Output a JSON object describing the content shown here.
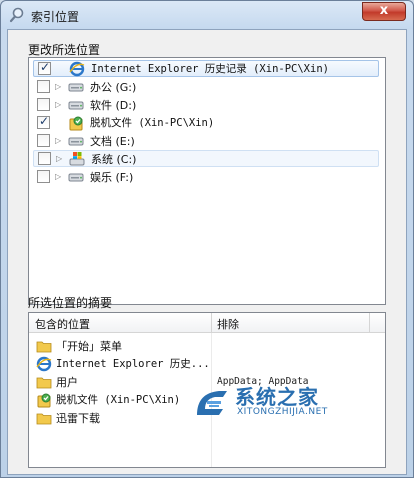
{
  "window": {
    "title": "索引位置",
    "close_glyph": "x"
  },
  "change_group": {
    "label": "更改所选位置",
    "items": [
      {
        "label": "Internet Explorer 历史记录 (Xin-PC\\Xin)",
        "checked": true,
        "icon": "ie-icon",
        "expandable": false
      },
      {
        "label": "办公 (G:)",
        "checked": false,
        "icon": "drive-icon",
        "expandable": true
      },
      {
        "label": "软件 (D:)",
        "checked": false,
        "icon": "drive-icon",
        "expandable": true
      },
      {
        "label": "脱机文件 (Xin-PC\\Xin)",
        "checked": true,
        "icon": "user-icon",
        "expandable": false
      },
      {
        "label": "文档 (E:)",
        "checked": false,
        "icon": "drive-icon",
        "expandable": true
      },
      {
        "label": "系统 (C:)",
        "checked": false,
        "icon": "sys-icon",
        "expandable": true
      },
      {
        "label": "娱乐 (F:)",
        "checked": false,
        "icon": "drive-icon",
        "expandable": true
      }
    ]
  },
  "summary_group": {
    "label": "所选位置的摘要",
    "columns": {
      "included": "包含的位置",
      "excluded": "排除"
    },
    "rows": [
      {
        "location": "「开始」菜单",
        "icon": "folder-icon",
        "exclude": ""
      },
      {
        "location": "Internet Explorer 历史...",
        "icon": "ie-icon",
        "exclude": ""
      },
      {
        "location": "用户",
        "icon": "folder-icon",
        "exclude": "AppData; AppData"
      },
      {
        "location": "脱机文件 (Xin-PC\\Xin)",
        "icon": "user-icon",
        "exclude": ""
      },
      {
        "location": "迅雷下载",
        "icon": "folder-icon",
        "exclude": ""
      }
    ]
  },
  "watermark": {
    "cn": "系统之家",
    "en": "XITONGZHIJIA.NET"
  },
  "colors": {
    "selection_border": "#a5c4e8",
    "close_red": "#c23a2a",
    "watermark_blue": "#2a6fb0"
  }
}
